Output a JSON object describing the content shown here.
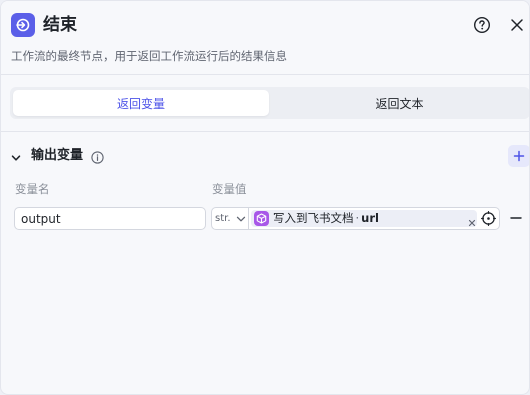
{
  "header": {
    "title": "结束",
    "description": "工作流的最终节点，用于返回工作流运行后的结果信息",
    "icons": {
      "node": "end-node-icon",
      "help": "help-icon",
      "close": "close-icon"
    }
  },
  "tabs": [
    {
      "label": "返回变量",
      "active": true
    },
    {
      "label": "返回文本",
      "active": false
    }
  ],
  "output_section": {
    "title": "输出变量",
    "columns": {
      "name": "变量名",
      "value": "变量值"
    },
    "rows": [
      {
        "name": "output",
        "type": "str.",
        "reference": {
          "node": "写入到飞书文档",
          "separator": "·",
          "field": "url",
          "icon": "cube-icon"
        }
      }
    ]
  },
  "colors": {
    "accent": "#4d53e8",
    "node_icon": "#5b5fe8",
    "reference_icon": "#a857e8",
    "background": "#f7f8fb"
  }
}
